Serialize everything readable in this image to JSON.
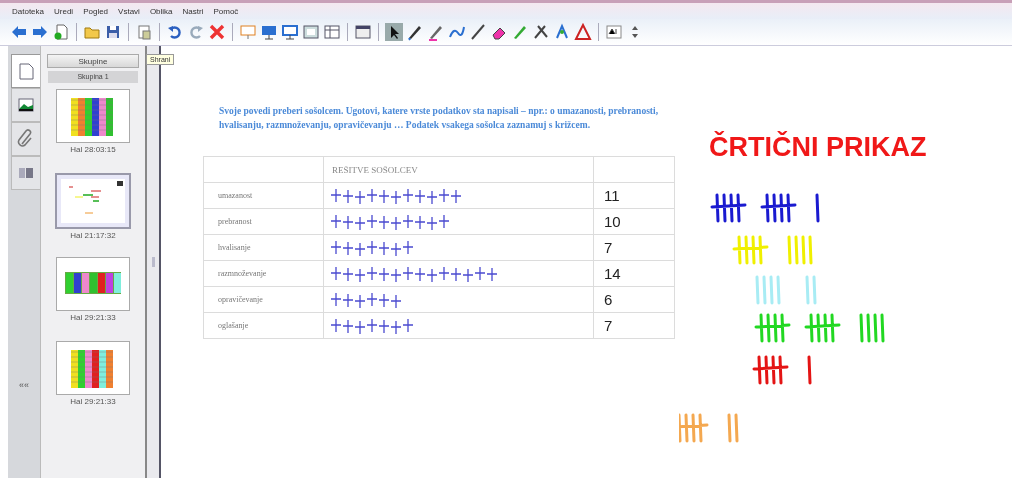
{
  "menu": [
    "Datoteka",
    "Uredi",
    "Pogled",
    "Vstavi",
    "Oblika",
    "Nastri",
    "Pomoč"
  ],
  "tooltip": "Shrani",
  "sidebar": {
    "tabs": [
      {
        "kind": "pages",
        "selected": true
      },
      {
        "kind": "gallery",
        "selected": false
      },
      {
        "kind": "attachments",
        "selected": false
      },
      {
        "kind": "properties",
        "selected": false
      }
    ],
    "collapse": "««",
    "group_button": "Skupine",
    "group_label": "Skupina 1",
    "pages": [
      {
        "caption": "Hal 28:03:15",
        "selected": false,
        "kind": "bars"
      },
      {
        "caption": "Hal 21:17:32",
        "selected": true,
        "kind": "sketch"
      },
      {
        "caption": "Hal 29:21:33",
        "selected": false,
        "kind": "wide"
      },
      {
        "caption": "Hal 29:21:33",
        "selected": false,
        "kind": "grid"
      }
    ]
  },
  "page": {
    "instruction": "Svoje povedi preberi sošolcem. Ugotovi, katere vrste podatkov sta napisali – npr.: o umazanosti, prebranosti, hvalisanju, razmnoževanju, opravičevanju … Podatek vsakega sošolca zaznamuj s križcem.",
    "table": {
      "columns": [
        "",
        "REŠITVE SOŠOLCEV",
        ""
      ],
      "rows": [
        {
          "label": "umazanost",
          "count": "11"
        },
        {
          "label": "prebranost",
          "count": "10"
        },
        {
          "label": "hvalisanje",
          "count": "7"
        },
        {
          "label": "razmnoževanje",
          "count": "14"
        },
        {
          "label": "opravičevanje",
          "count": "6"
        },
        {
          "label": "oglašanje",
          "count": "7"
        }
      ]
    },
    "title": "ČRTIČNI PRIKAZ",
    "tallies": [
      {
        "color": "#1a1ad0"
      },
      {
        "color": "#f0f000"
      },
      {
        "color": "#a8ecf4"
      },
      {
        "color": "#22d822"
      },
      {
        "color": "#e41414"
      },
      {
        "color": "#f4a850"
      }
    ]
  }
}
